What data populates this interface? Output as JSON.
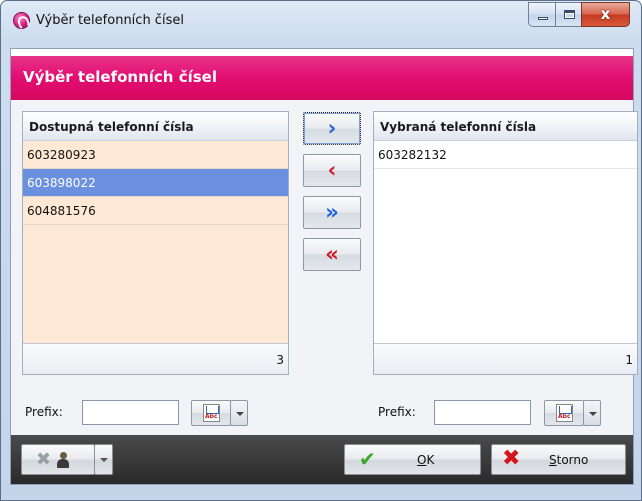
{
  "window": {
    "title": "Výběr telefonních čísel",
    "close_glyph": "x"
  },
  "header": {
    "title": "Výběr telefonních čísel"
  },
  "available": {
    "heading": "Dostupná telefonní čísla",
    "items": [
      "603280923",
      "603898022",
      "604881576"
    ],
    "selected_index": 1,
    "count": "3",
    "prefix_label": "Prefix:",
    "prefix_value": ""
  },
  "chosen": {
    "heading": "Vybraná telefonní čísla",
    "items": [
      "603282132"
    ],
    "count": "1",
    "prefix_label": "Prefix:",
    "prefix_value": ""
  },
  "move_buttons": {
    "add_one": "›",
    "remove_one": "‹",
    "add_all": "»",
    "remove_all": "«"
  },
  "footer": {
    "ok_prefix": "",
    "ok_hotkey": "O",
    "ok_rest": "K",
    "cancel_hotkey": "S",
    "cancel_rest": "torno"
  },
  "colors": {
    "header": "#e20d71",
    "available_bg": "#fde9d5",
    "selection": "#6a90df",
    "footer": "#333333"
  },
  "icons": {
    "app": "pink-app-icon",
    "spell": "abc-checker-icon",
    "user_clear": "user-clear-icon",
    "ok": "check-icon",
    "cancel": "red-x-icon"
  }
}
